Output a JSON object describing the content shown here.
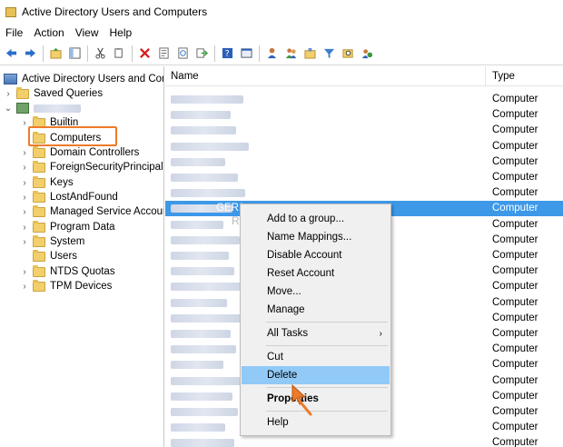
{
  "window": {
    "title": "Active Directory Users and Computers"
  },
  "menu": [
    "File",
    "Action",
    "View",
    "Help"
  ],
  "toolbar_icons": [
    "back-arrow-icon",
    "forward-arrow-icon",
    "up-folder-icon",
    "show-hide-tree-icon",
    "cut-icon",
    "copy-icon",
    "delete-x-icon",
    "properties-icon",
    "refresh-icon",
    "export-list-icon",
    "help-icon",
    "console-icon",
    "new-user-icon",
    "new-group-icon",
    "new-ou-icon",
    "filter-icon",
    "find-icon",
    "add-to-group-icon"
  ],
  "tree": {
    "root": "Active Directory Users and Com",
    "saved_queries": "Saved Queries",
    "items": [
      "Builtin",
      "Computers",
      "Domain Controllers",
      "ForeignSecurityPrincipals",
      "Keys",
      "LostAndFound",
      "Managed Service Accour",
      "Program Data",
      "System",
      "Users",
      "NTDS Quotas",
      "TPM Devices"
    ]
  },
  "list": {
    "columns": [
      "Name",
      "Type"
    ],
    "row_type": "Computer",
    "selected_name_fragment": "GER1",
    "rows": [
      "Computer",
      "Computer",
      "Computer",
      "Computer",
      "Computer",
      "Computer",
      "Computer",
      "Computer",
      "Computer",
      "Computer",
      "Computer",
      "Computer",
      "Computer",
      "Computer",
      "Computer",
      "Computer",
      "Computer",
      "Computer",
      "Computer",
      "Computer",
      "Computer",
      "Computer",
      "Computer"
    ]
  },
  "context_menu": {
    "items": [
      "Add to a group...",
      "Name Mappings...",
      "Disable Account",
      "Reset Account",
      "Move...",
      "Manage",
      "All Tasks",
      "Cut",
      "Delete",
      "Properties",
      "Help"
    ],
    "hover": "Delete"
  },
  "watermark": "RepairWin.com",
  "colors": {
    "selection": "#3d98e8",
    "hover": "#91c9f7",
    "highlight_box": "#ee7b2a"
  }
}
